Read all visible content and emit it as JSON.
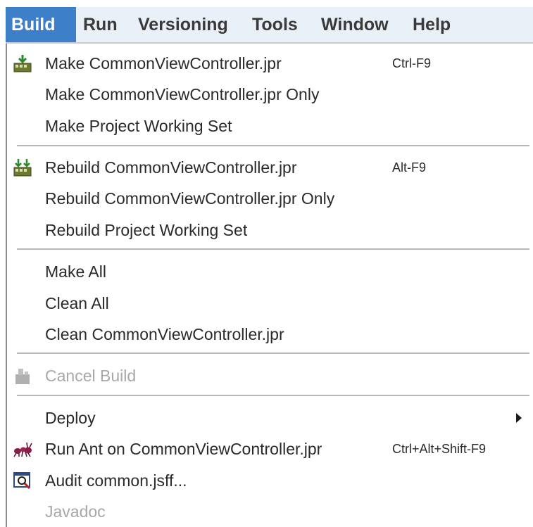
{
  "menubar": {
    "items": [
      {
        "label": "Build",
        "active": true
      },
      {
        "label": "Run"
      },
      {
        "label": "Versioning"
      },
      {
        "label": "Tools"
      },
      {
        "label": "Window"
      },
      {
        "label": "Help"
      }
    ]
  },
  "build_menu": {
    "items": [
      {
        "label": "Make CommonViewController.jpr",
        "shortcut": "Ctrl-F9",
        "icon": "make-icon"
      },
      {
        "label": "Make CommonViewController.jpr Only"
      },
      {
        "label": "Make Project Working Set"
      },
      {
        "label": "Rebuild CommonViewController.jpr",
        "shortcut": "Alt-F9",
        "icon": "rebuild-icon"
      },
      {
        "label": "Rebuild CommonViewController.jpr Only"
      },
      {
        "label": "Rebuild Project Working Set"
      },
      {
        "label": "Make All"
      },
      {
        "label": "Clean All"
      },
      {
        "label": "Clean CommonViewController.jpr"
      },
      {
        "label": "Cancel Build",
        "icon": "cancel-build-icon",
        "disabled": true
      },
      {
        "label": "Deploy",
        "submenu": true
      },
      {
        "label": "Run Ant on CommonViewController.jpr",
        "shortcut": "Ctrl+Alt+Shift-F9",
        "icon": "ant-icon"
      },
      {
        "label": "Audit common.jsff...",
        "icon": "audit-icon"
      },
      {
        "label": "Javadoc",
        "disabled": true
      }
    ]
  },
  "colors": {
    "menubar_bg": "#eaf0f8",
    "active_bg": "#3d7fc8",
    "disabled_text": "#a8a8a8",
    "separator": "#b8b8b8"
  }
}
